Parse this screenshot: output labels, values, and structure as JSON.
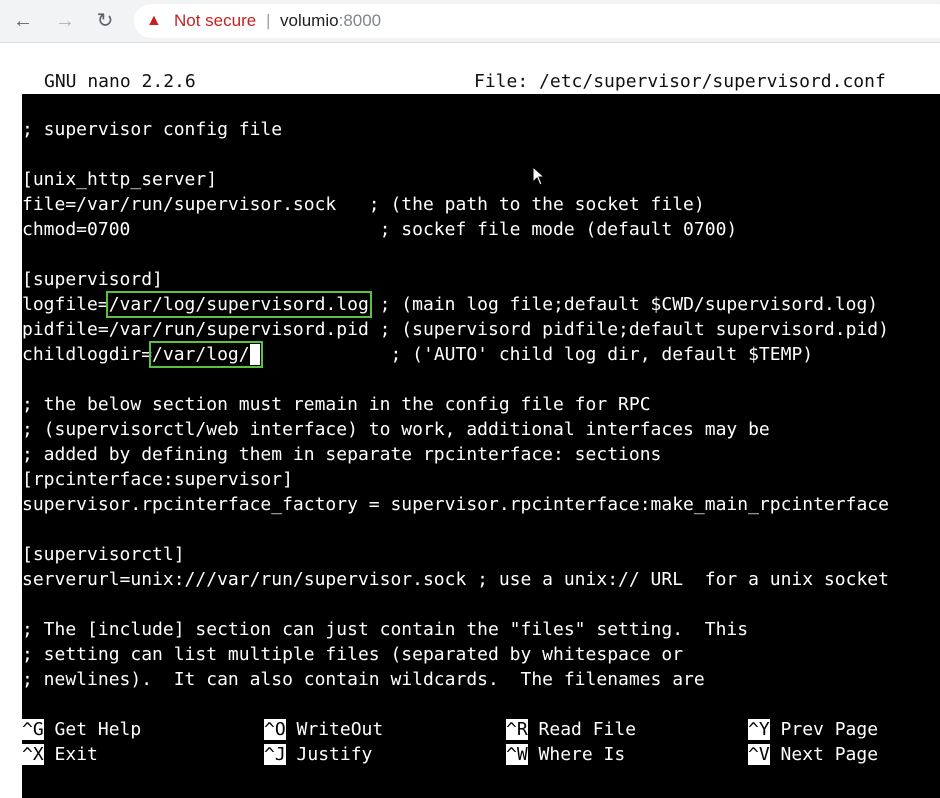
{
  "browser": {
    "security_text": "Not secure",
    "url_host": "volumio",
    "url_port": ":8000"
  },
  "nano": {
    "title_left": "GNU nano 2.2.6",
    "title_right": "File: /etc/supervisor/supervisord.conf",
    "lines": [
      "; supervisor config file",
      "",
      "[unix_http_server]",
      "file=/var/run/supervisor.sock   ; (the path to the socket file)",
      "chmod=0700                       ; sockef file mode (default 0700)",
      "",
      "[supervisord]",
      "",
      "pidfile=/var/run/supervisord.pid ; (supervisord pidfile;default supervisord.pid)",
      "",
      "",
      "; the below section must remain in the config file for RPC",
      "; (supervisorctl/web interface) to work, additional interfaces may be",
      "; added by defining them in separate rpcinterface: sections",
      "[rpcinterface:supervisor]",
      "supervisor.rpcinterface_factory = supervisor.rpcinterface:make_main_rpcinterface",
      "",
      "[supervisorctl]",
      "serverurl=unix:///var/run/supervisor.sock ; use a unix:// URL  for a unix socket",
      "",
      "; The [include] section can just contain the \"files\" setting.  This",
      "; setting can list multiple files (separated by whitespace or",
      "; newlines).  It can also contain wildcards.  The filenames are"
    ],
    "logfile_line": {
      "prefix": "logfile=",
      "value": "/var/log/supervisord.log",
      "suffix": " ; (main log file;default $CWD/supervisord.log)"
    },
    "childlogdir_line": {
      "prefix": "childlogdir=",
      "value": "/var/log/",
      "suffix": "            ; ('AUTO' child log dir, default $TEMP)"
    },
    "help": [
      {
        "key": "^G",
        "label": "Get Help"
      },
      {
        "key": "^O",
        "label": "WriteOut"
      },
      {
        "key": "^R",
        "label": "Read File"
      },
      {
        "key": "^Y",
        "label": "Prev Page"
      },
      {
        "key": "^X",
        "label": "Exit"
      },
      {
        "key": "^J",
        "label": "Justify"
      },
      {
        "key": "^W",
        "label": "Where Is"
      },
      {
        "key": "^V",
        "label": "Next Page"
      }
    ]
  },
  "colors": {
    "highlight": "#59c341",
    "warning": "#c5221f"
  },
  "icons": [
    "back-arrow-icon",
    "forward-arrow-icon",
    "reload-icon",
    "warning-icon",
    "mouse-pointer-icon"
  ]
}
